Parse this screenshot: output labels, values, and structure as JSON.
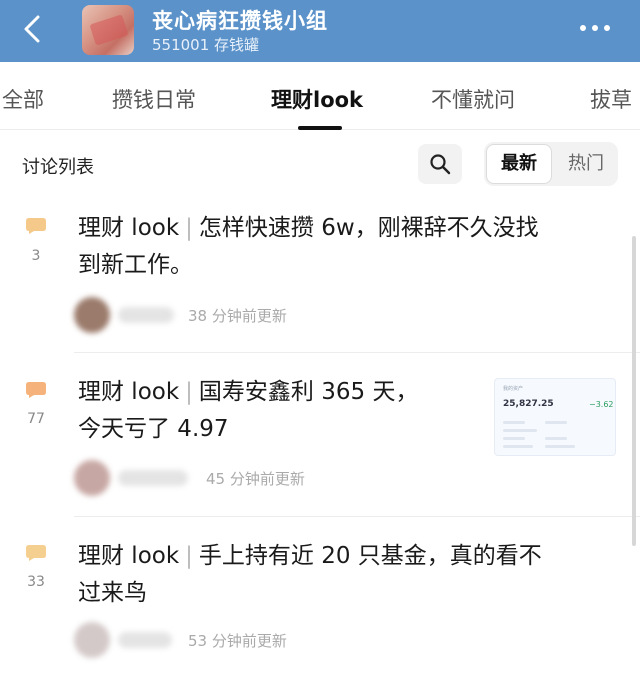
{
  "header": {
    "title": "丧心病狂攒钱小组",
    "subtitle": "551001 存钱罐"
  },
  "tabs": [
    {
      "label": "全部",
      "active": false
    },
    {
      "label": "攒钱日常",
      "active": false
    },
    {
      "label": "理财look",
      "active": true
    },
    {
      "label": "不懂就问",
      "active": false
    },
    {
      "label": "拔草",
      "active": false
    }
  ],
  "list": {
    "title": "讨论列表",
    "sort_latest": "最新",
    "sort_hot": "热门"
  },
  "posts": [
    {
      "tag": "理财 look",
      "title_line1": "怎样快速攒 6w，刚裸辞不久没找",
      "title_line2": "到新工作。",
      "comments": "3",
      "time": "38 分钟前更新"
    },
    {
      "tag": "理财 look",
      "title_line1": "国寿安鑫利 365 天，",
      "title_line2": "今天亏了 4.97",
      "comments": "77",
      "time": "45 分钟前更新",
      "thumbnail": {
        "label_total": "我的资产",
        "amount": "25,827.25",
        "change": "−3.62"
      }
    },
    {
      "tag": "理财 look",
      "title_line1": "手上持有近 20 只基金，真的看不",
      "title_line2": "过来鸟",
      "comments": "33",
      "time": "53 分钟前更新"
    }
  ],
  "colors": {
    "header_bg": "#5b92c9",
    "comment_icon": "#f5c98a",
    "active_tab": "#111111"
  }
}
